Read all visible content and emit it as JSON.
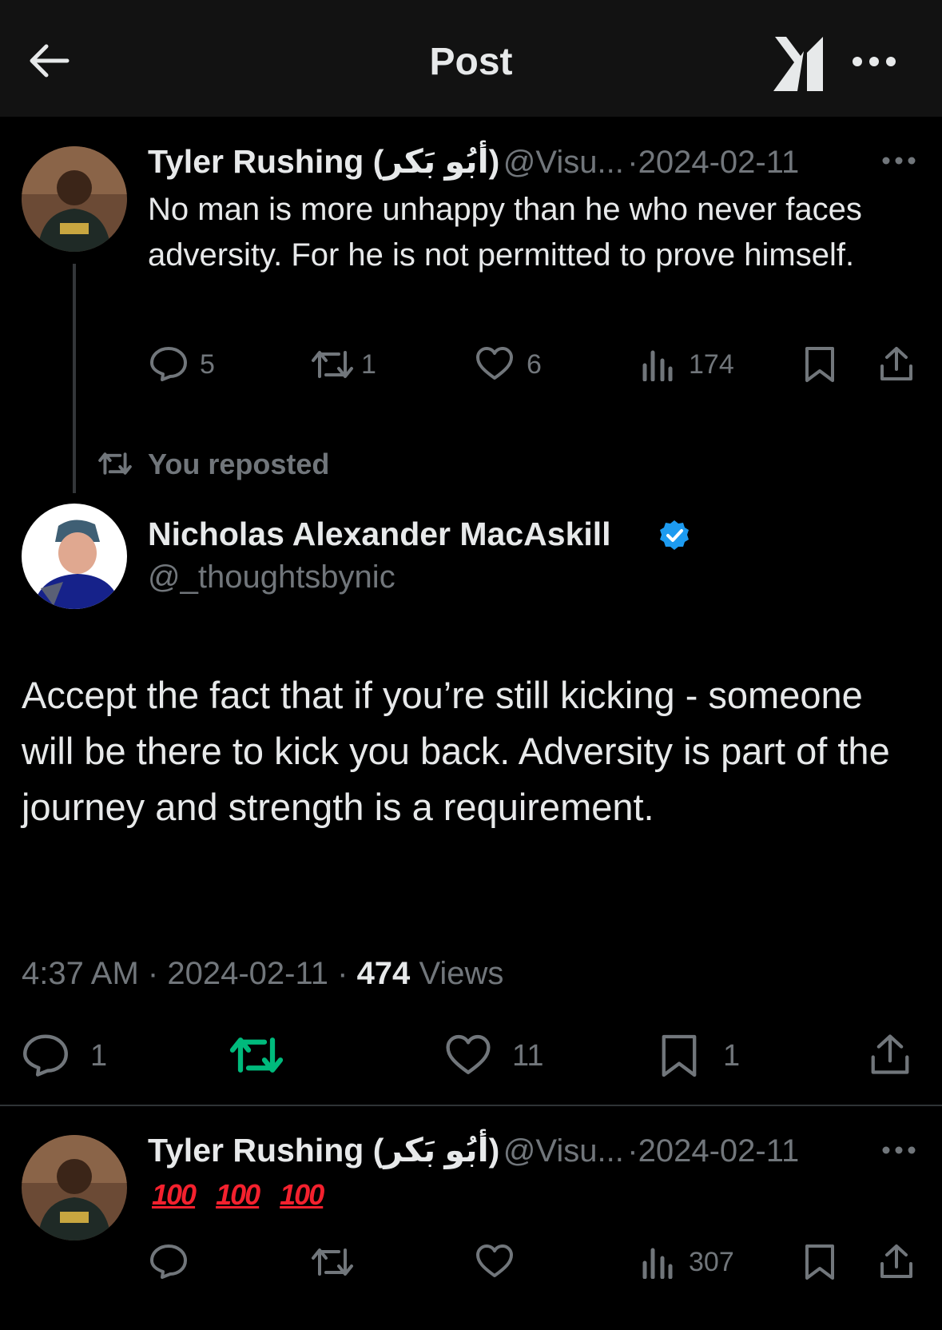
{
  "header": {
    "title": "Post"
  },
  "parent_post": {
    "display_name": "Tyler Rushing (أبُو بَكر)",
    "handle": "@Visu...",
    "separator": "·",
    "date": "2024-02-11",
    "text": "No man is more unhappy than he who never faces adversity. For he is not permitted to prove himself.",
    "stats": {
      "replies": "5",
      "reposts": "1",
      "likes": "6",
      "views": "174"
    }
  },
  "repost_banner": {
    "label": "You reposted"
  },
  "main_post": {
    "display_name": "Nicholas Alexander MacAskill",
    "verified": true,
    "handle": "@_thoughtsbynic",
    "text": "Accept the fact that if you’re still kicking - someone will be there to kick you back. Adversity is part of the journey and strength is a requirement.",
    "time": "4:37 AM",
    "separator": "·",
    "date": "2024-02-11",
    "views_count": "474",
    "views_label": "Views",
    "stats": {
      "replies": "1",
      "likes": "11",
      "bookmarks": "1"
    },
    "repost_active_color": "#00ba7c"
  },
  "reply_post": {
    "display_name": "Tyler Rushing (أبُو بَكر)",
    "handle": "@Visu...",
    "separator": "·",
    "date": "2024-02-11",
    "emojis": [
      "100",
      "100",
      "100"
    ],
    "stats": {
      "views": "307"
    }
  },
  "colors": {
    "background": "#000000",
    "header": "#121212",
    "text": "#e7e9ea",
    "secondary": "#71767b",
    "verified": "#1d9bf0",
    "emoji_red": "#f4212e"
  }
}
